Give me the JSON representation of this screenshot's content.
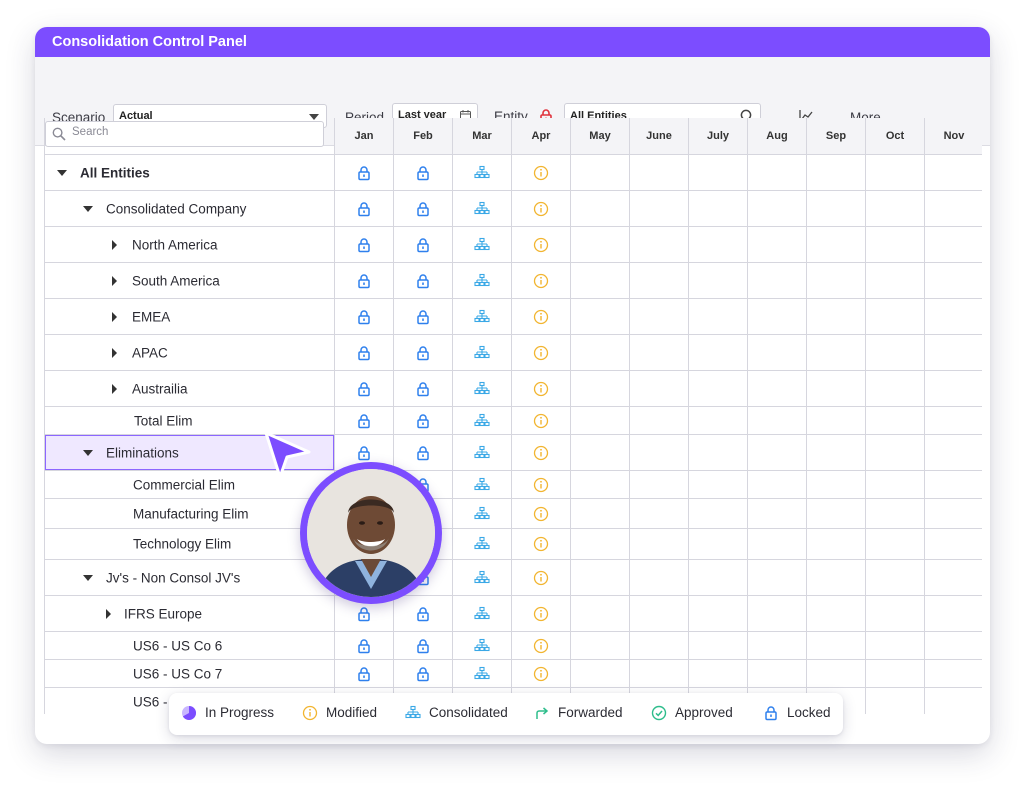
{
  "window": {
    "title": "Consolidation Control Panel"
  },
  "toolbar": {
    "scenario_label": "Scenario",
    "scenario_value": "Actual",
    "period_label": "Period",
    "period_value": "Last year",
    "entity_label": "Entity",
    "entity_value": "All Entities",
    "more_label": "More"
  },
  "grid": {
    "search_placeholder": "Search",
    "months": [
      "Jan",
      "Feb",
      "Mar",
      "Apr",
      "May",
      "June",
      "July",
      "Aug",
      "Sep",
      "Oct",
      "Nov"
    ],
    "rows": [
      {
        "label": "All Entities",
        "bold": true,
        "caret": "down",
        "status": [
          "locked",
          "locked",
          "consolidated",
          "modified"
        ]
      },
      {
        "label": "Consolidated Company",
        "caret": "down",
        "status": [
          "locked",
          "locked",
          "consolidated",
          "modified"
        ]
      },
      {
        "label": "North America",
        "caret": "right",
        "status": [
          "locked",
          "locked",
          "consolidated",
          "modified"
        ]
      },
      {
        "label": "South America",
        "caret": "right",
        "status": [
          "locked",
          "locked",
          "consolidated",
          "modified"
        ]
      },
      {
        "label": "EMEA",
        "caret": "right",
        "status": [
          "locked",
          "locked",
          "consolidated",
          "modified"
        ]
      },
      {
        "label": "APAC",
        "caret": "right",
        "status": [
          "locked",
          "locked",
          "consolidated",
          "modified"
        ]
      },
      {
        "label": "Austrailia",
        "caret": "right",
        "status": [
          "locked",
          "locked",
          "consolidated",
          "modified"
        ]
      },
      {
        "label": "Total Elim",
        "caret": "none",
        "status": [
          "locked",
          "locked",
          "consolidated",
          "modified"
        ]
      },
      {
        "label": "Eliminations",
        "caret": "down",
        "selected": true,
        "status": [
          "locked",
          "locked",
          "consolidated",
          "modified"
        ]
      },
      {
        "label": "Commercial Elim",
        "caret": "none",
        "status": [
          "locked",
          "locked",
          "consolidated",
          "modified"
        ]
      },
      {
        "label": "Manufacturing Elim",
        "caret": "none",
        "status": [
          "locked",
          "locked",
          "consolidated",
          "modified"
        ]
      },
      {
        "label": "Technology Elim",
        "caret": "none",
        "status": [
          "locked",
          "locked",
          "consolidated",
          "modified"
        ]
      },
      {
        "label": "Jv's - Non Consol JV's",
        "caret": "down",
        "status": [
          "locked",
          "locked",
          "consolidated",
          "modified"
        ]
      },
      {
        "label": "IFRS Europe",
        "caret": "right",
        "status": [
          "locked",
          "locked",
          "consolidated",
          "modified"
        ]
      },
      {
        "label": "US6 - US Co 6",
        "caret": "none",
        "status": [
          "locked",
          "locked",
          "consolidated",
          "modified"
        ]
      },
      {
        "label": "US6 - US Co 7",
        "caret": "none",
        "status": [
          "locked",
          "locked",
          "consolidated",
          "modified"
        ]
      },
      {
        "label": "US6 - US Co 8",
        "caret": "none",
        "status": [
          "locked",
          "locked",
          "consolidated",
          "modified"
        ]
      }
    ]
  },
  "legend": [
    {
      "icon": "in-progress-icon",
      "label": "In Progress"
    },
    {
      "icon": "modified-icon",
      "label": "Modified"
    },
    {
      "icon": "consolidated-icon",
      "label": "Consolidated"
    },
    {
      "icon": "forwarded-icon",
      "label": "Forwarded"
    },
    {
      "icon": "approved-icon",
      "label": "Approved"
    },
    {
      "icon": "locked-icon",
      "label": "Locked"
    }
  ],
  "colors": {
    "accent": "#7c4dff",
    "locked": "#2f80ed",
    "consolidated": "#3aa8e6",
    "modified": "#f2b530",
    "forwarded": "#2ebd8c",
    "approved": "#2ebd8c",
    "in_progress": "#7c4dff",
    "entity_lock": "#e0323c"
  }
}
